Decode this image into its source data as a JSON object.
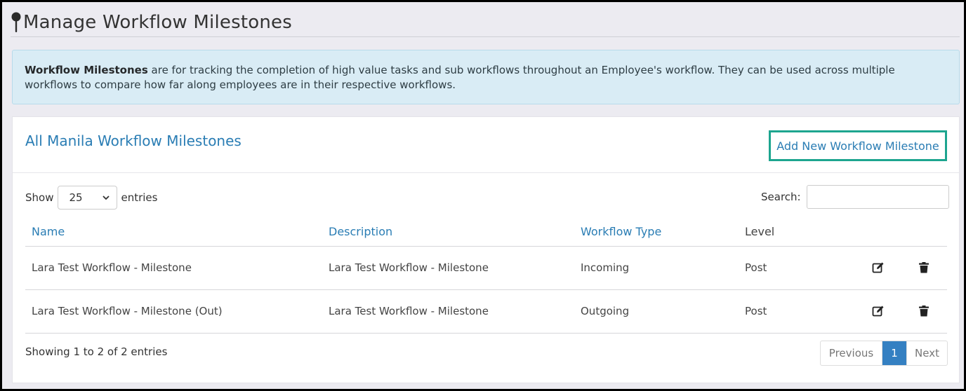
{
  "header": {
    "title": "Manage Workflow Milestones",
    "icon": "map-pin-icon"
  },
  "info": {
    "bold": "Workflow Milestones",
    "text": " are for tracking the completion of high value tasks and sub workflows throughout an Employee's workflow. They can be used across multiple workflows to compare how far along employees are in their respective workflows."
  },
  "panel": {
    "title": "All Manila Workflow Milestones",
    "add_button": "Add New Workflow Milestone"
  },
  "controls": {
    "show_label": "Show",
    "entries_value": "25",
    "entries_label": "entries",
    "search_label": "Search:",
    "search_value": ""
  },
  "table": {
    "headers": [
      "Name",
      "Description",
      "Workflow Type",
      "Level"
    ],
    "rows": [
      {
        "name": "Lara Test Workflow - Milestone",
        "description": "Lara Test Workflow - Milestone",
        "type": "Incoming",
        "level": "Post"
      },
      {
        "name": "Lara Test Workflow - Milestone (Out)",
        "description": "Lara Test Workflow - Milestone",
        "type": "Outgoing",
        "level": "Post"
      }
    ]
  },
  "footer": {
    "info": "Showing 1 to 2 of 2 entries",
    "prev": "Previous",
    "page": "1",
    "next": "Next"
  },
  "colors": {
    "accent": "#2a7db4",
    "highlight_border": "#1da58f",
    "active_page": "#3480c2"
  }
}
